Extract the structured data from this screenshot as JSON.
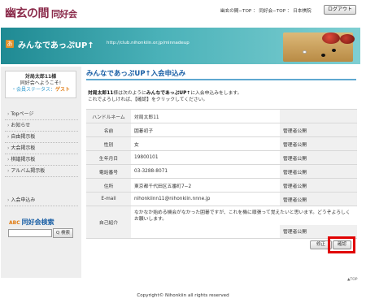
{
  "header": {
    "logo": "幽玄の間",
    "logo_sub": "同好会",
    "nav": "幽玄の間−TOP ： 同好会−TOP ： 日本棋院",
    "logout_label": "ログアウト"
  },
  "banner": {
    "icon": "あ",
    "title": "みんなであっぷUP↑",
    "url": "http://club.nihonkiin.or.jp/minnadeup"
  },
  "sidebar": {
    "user_name": "対局太郎11様",
    "welcome": "同好会へようこそ!",
    "status_label": "・会員ステータス：",
    "status_value": "ゲスト",
    "menu": [
      "Topページ",
      "お知らせ",
      "自由掲示板",
      "大会掲示板",
      "棋譜掲示板",
      "アルバム掲示板"
    ],
    "join_label": "入会申込み",
    "search_title": "同好会検索",
    "search_badge": "ABC",
    "search_button": "Q 検索"
  },
  "main": {
    "page_title": "みんなであっぷUP↑入会申込み",
    "intro_line1_bold1": "対局太郎11",
    "intro_line1_mid": "様は次のように",
    "intro_line1_bold2": "みんなであっぷUP↑",
    "intro_line1_end": "に入会申込みをします。",
    "intro_line2": "これでよろしければ、【確認】をクリックしてください。",
    "rows": [
      {
        "label": "ハンドルネーム",
        "value": "対局太郎11",
        "public": ""
      },
      {
        "label": "名前",
        "value": "囲碁初子",
        "public": "管理者公開"
      },
      {
        "label": "性別",
        "value": "女",
        "public": "管理者公開"
      },
      {
        "label": "生年月日",
        "value": "19800101",
        "public": "管理者公開"
      },
      {
        "label": "電話番号",
        "value": "03-3288-8071",
        "public": "管理者公開"
      },
      {
        "label": "住所",
        "value": "東京都千代田区五番町7−2",
        "public": "管理者公開"
      },
      {
        "label": "E-mail",
        "value": "nihonkiinn11@nihonkiin.nnne.jp",
        "public": "管理者公開"
      },
      {
        "label": "自己紹介",
        "value": "なかなか始める機会がなかった囲碁ですが、これを機に頑張って覚えたいと思います。どうぞよろしくお願いします。",
        "public": "管理者公開"
      }
    ],
    "fix_label": "修正",
    "confirm_label": "確認",
    "totop": "▲TOP"
  },
  "footer": {
    "copyright": "Copyright© Nihonkiin all rights reserved"
  },
  "colors": {
    "accent": "#1a5fa5",
    "logo": "#8a2a4a",
    "banner": "#2a9aa2",
    "highlight": "#e00000",
    "status": "#e07a10"
  }
}
